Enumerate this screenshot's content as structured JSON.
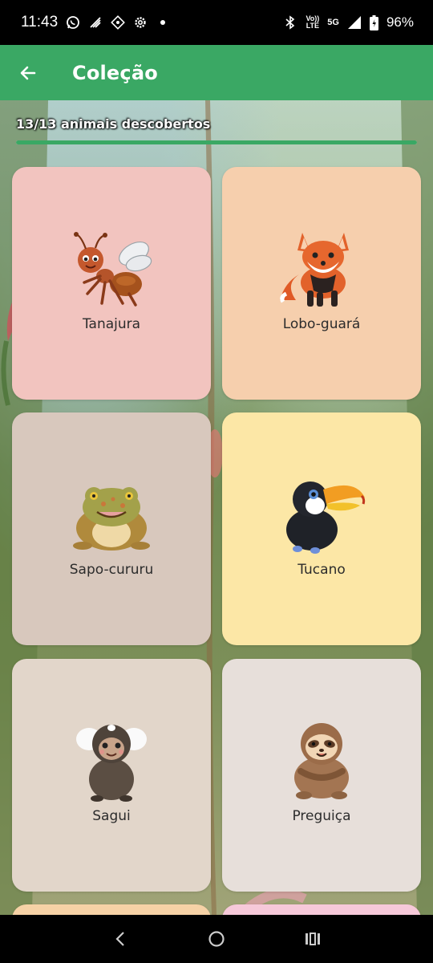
{
  "status_bar": {
    "time": "11:43",
    "network_top": "Vo))",
    "network_bottom": "LTE",
    "signal_type": "5G",
    "battery": "96%",
    "icons": [
      "whatsapp-icon",
      "signal-boost-icon",
      "data-saver-icon",
      "settings-icon",
      "dot-icon",
      "bluetooth-icon",
      "cell-signal-icon",
      "battery-icon"
    ]
  },
  "app_bar": {
    "title": "Coleção",
    "back_icon": "arrow-left-icon",
    "color": "#3aa864"
  },
  "progress": {
    "label": "13/13 animais descobertos",
    "discovered": 13,
    "total": 13,
    "fraction": 1.0
  },
  "animals": [
    {
      "name": "Tanajura",
      "icon": "ant-icon",
      "color": "#f2c4bf"
    },
    {
      "name": "Lobo-guará",
      "icon": "maned-wolf-icon",
      "color": "#f6cfad"
    },
    {
      "name": "Sapo-cururu",
      "icon": "toad-icon",
      "color": "#d8c8bd"
    },
    {
      "name": "Tucano",
      "icon": "toucan-icon",
      "color": "#fce7a6"
    },
    {
      "name": "Sagui",
      "icon": "marmoset-icon",
      "color": "#e2d6ca"
    },
    {
      "name": "Preguiça",
      "icon": "sloth-icon",
      "color": "#e7dfda"
    }
  ],
  "nav_bar": {
    "icons": [
      "back-nav-icon",
      "home-nav-icon",
      "recents-nav-icon"
    ]
  }
}
